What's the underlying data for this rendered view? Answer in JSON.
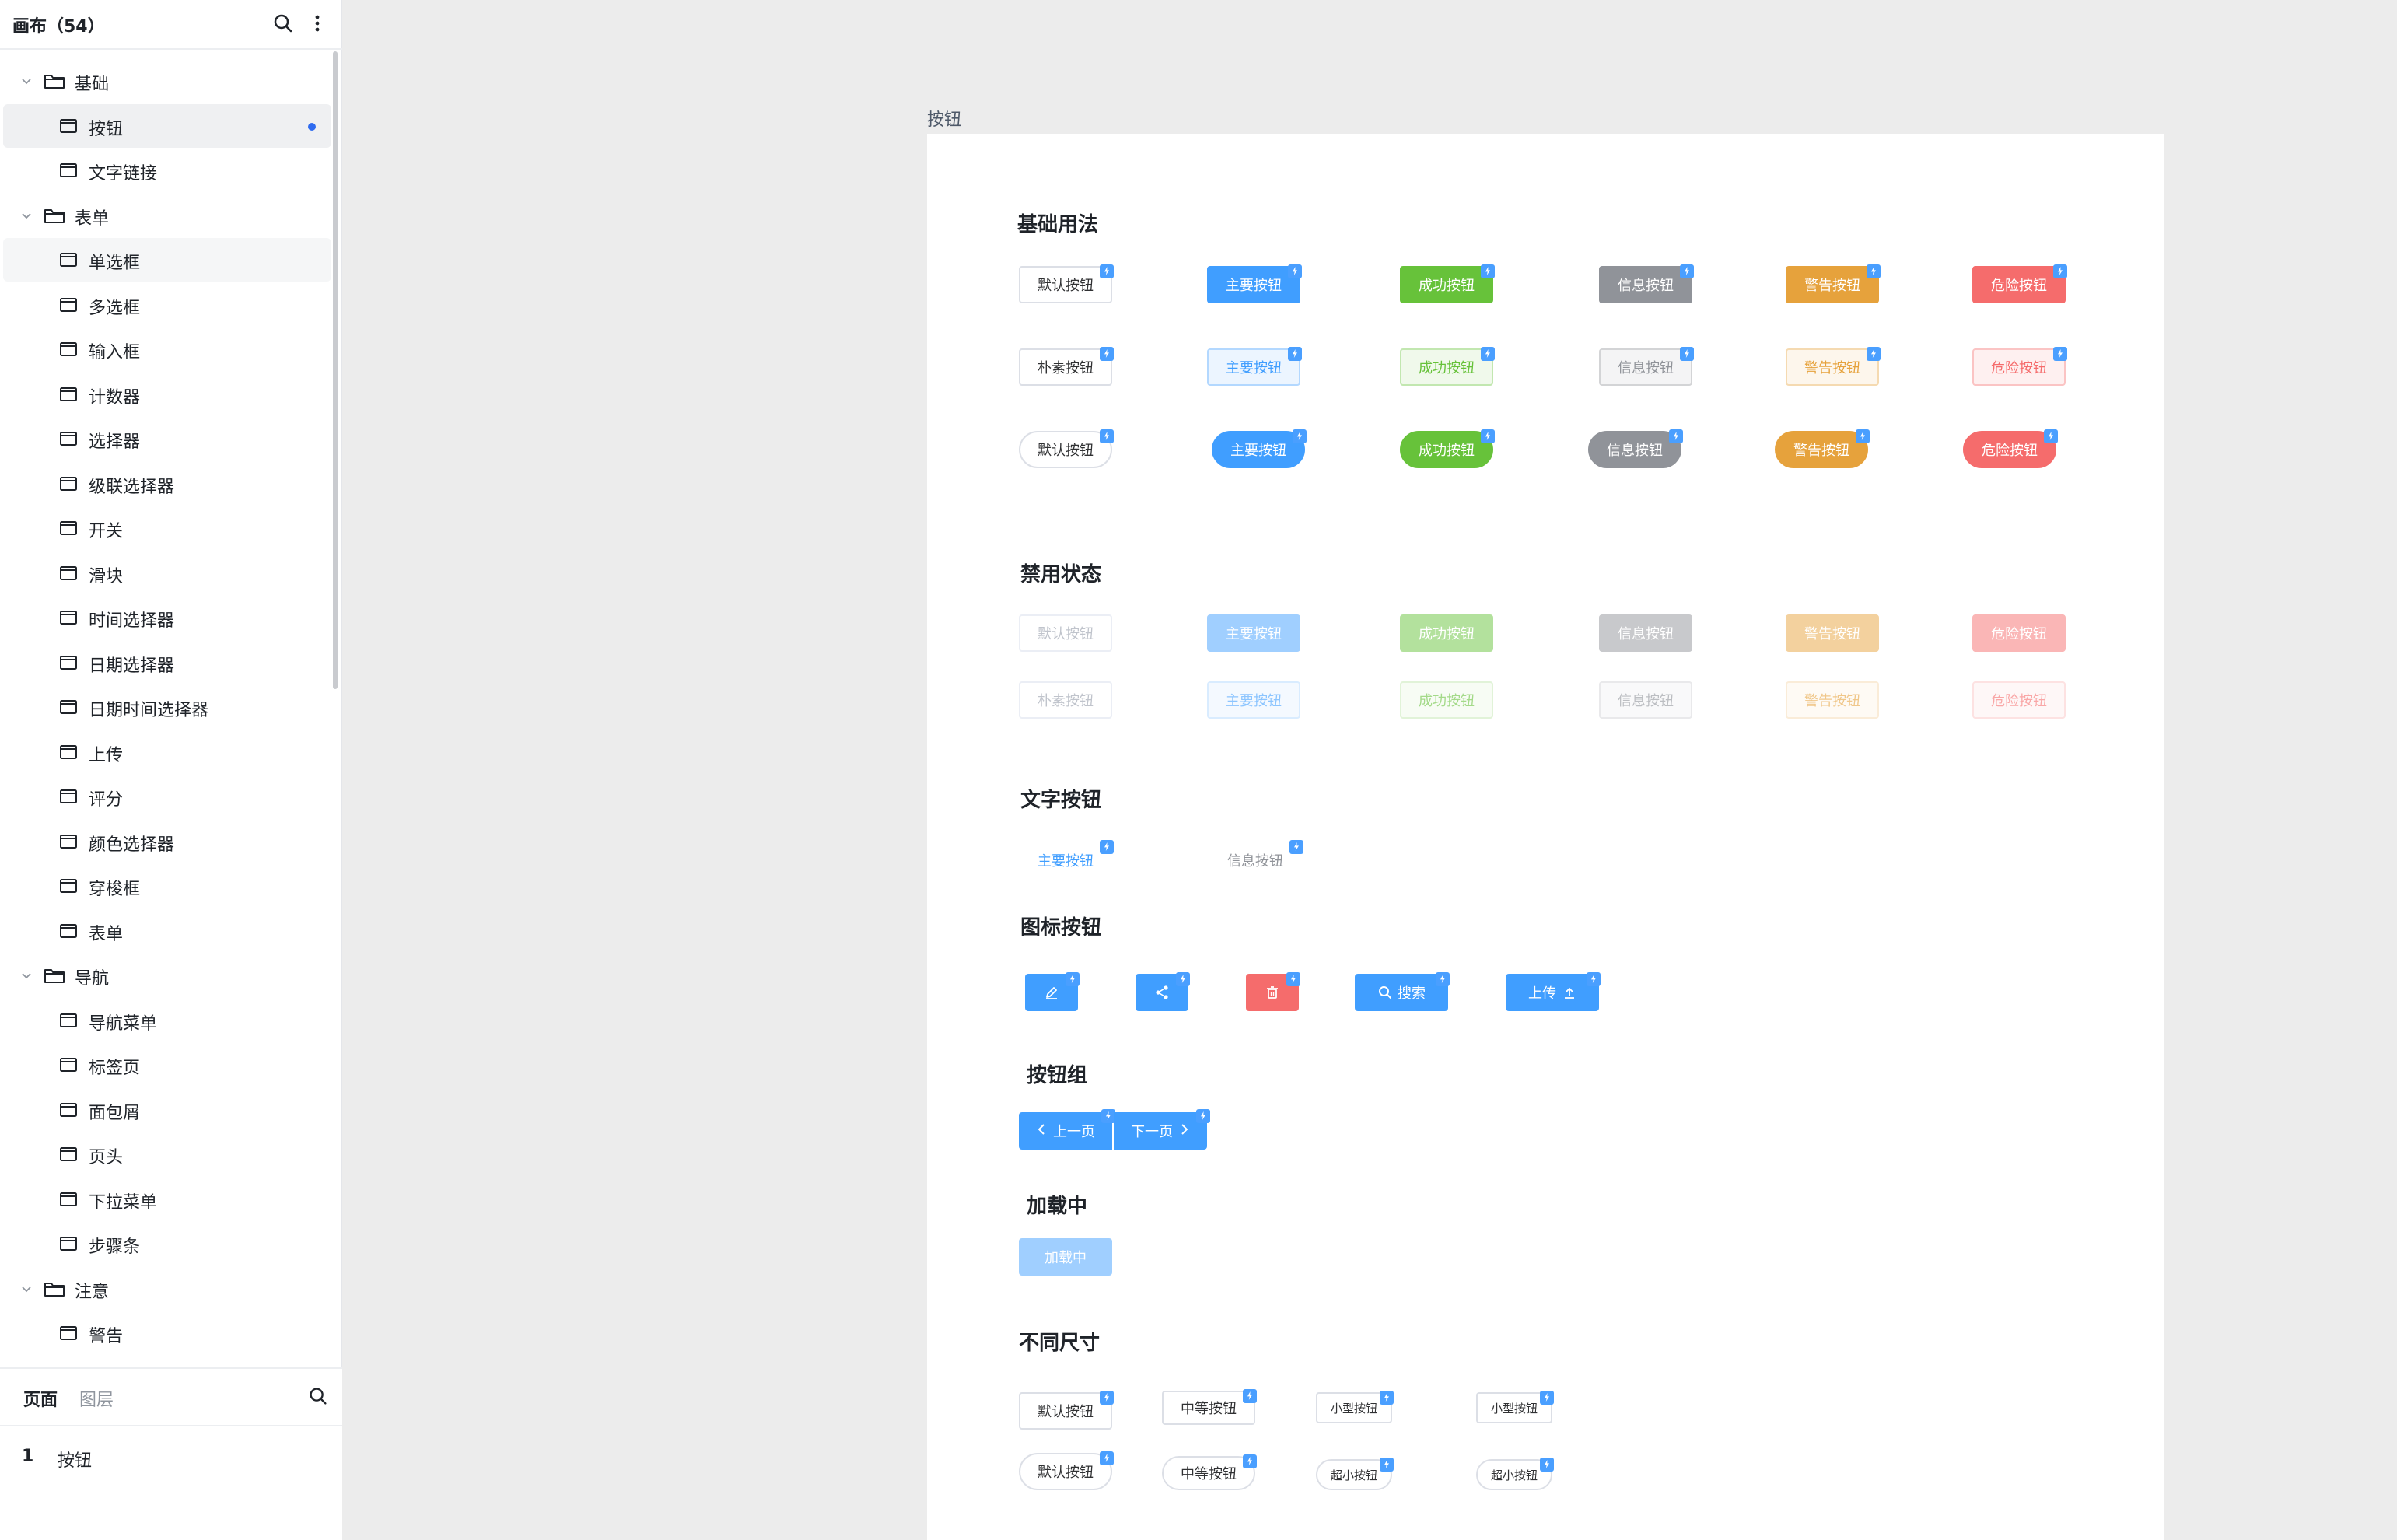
{
  "sidebar": {
    "title": "画布（54）",
    "tree": [
      {
        "kind": "folder",
        "label": "基础"
      },
      {
        "kind": "page",
        "label": "按钮",
        "selected": true
      },
      {
        "kind": "page",
        "label": "文字链接"
      },
      {
        "kind": "folder",
        "label": "表单"
      },
      {
        "kind": "page",
        "label": "单选框",
        "hover": true
      },
      {
        "kind": "page",
        "label": "多选框"
      },
      {
        "kind": "page",
        "label": "输入框"
      },
      {
        "kind": "page",
        "label": "计数器"
      },
      {
        "kind": "page",
        "label": "选择器"
      },
      {
        "kind": "page",
        "label": "级联选择器"
      },
      {
        "kind": "page",
        "label": "开关"
      },
      {
        "kind": "page",
        "label": "滑块"
      },
      {
        "kind": "page",
        "label": "时间选择器"
      },
      {
        "kind": "page",
        "label": "日期选择器"
      },
      {
        "kind": "page",
        "label": "日期时间选择器"
      },
      {
        "kind": "page",
        "label": "上传"
      },
      {
        "kind": "page",
        "label": "评分"
      },
      {
        "kind": "page",
        "label": "颜色选择器"
      },
      {
        "kind": "page",
        "label": "穿梭框"
      },
      {
        "kind": "page",
        "label": "表单"
      },
      {
        "kind": "folder",
        "label": "导航"
      },
      {
        "kind": "page",
        "label": "导航菜单"
      },
      {
        "kind": "page",
        "label": "标签页"
      },
      {
        "kind": "page",
        "label": "面包屑"
      },
      {
        "kind": "page",
        "label": "页头"
      },
      {
        "kind": "page",
        "label": "下拉菜单"
      },
      {
        "kind": "page",
        "label": "步骤条"
      },
      {
        "kind": "folder",
        "label": "注意"
      },
      {
        "kind": "page",
        "label": "警告"
      }
    ],
    "bottom_tabs": {
      "pages": "页面",
      "layers": "图层"
    },
    "pages_list": [
      {
        "num": "1",
        "name": "按钮"
      }
    ]
  },
  "canvas": {
    "frame_label": "按钮",
    "sections": {
      "basic": "基础用法",
      "disabled": "禁用状态",
      "text": "文字按钮",
      "icon": "图标按钮",
      "group": "按钮组",
      "loading": "加载中",
      "sizes": "不同尺寸"
    },
    "labels": {
      "default": "默认按钮",
      "primary": "主要按钮",
      "success": "成功按钮",
      "info": "信息按钮",
      "warning": "警告按钮",
      "danger": "危险按钮",
      "plain": "朴素按钮",
      "search": "搜索",
      "upload": "上传",
      "prev": "上一页",
      "next": "下一页",
      "loading": "加载中",
      "medium": "中等按钮",
      "small": "小型按钮",
      "mini": "超小按钮"
    }
  },
  "colors": {
    "primary": "#409eff",
    "success": "#67c23a",
    "info": "#909399",
    "warning": "#e6a23c",
    "danger": "#f56c6c",
    "selected_dot": "#2f6bf0"
  }
}
